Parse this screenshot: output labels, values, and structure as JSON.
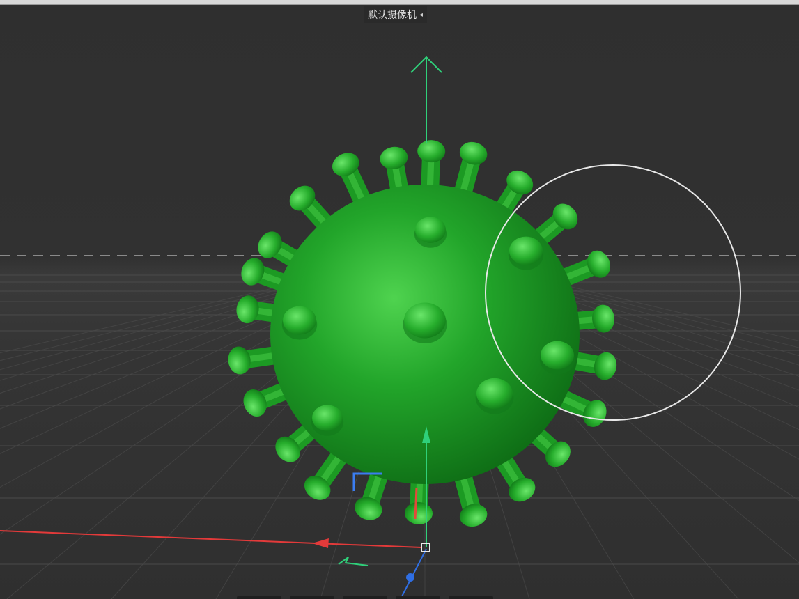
{
  "viewport": {
    "camera_label": "默认摄像机",
    "camera_icon": "camera-icon",
    "camera_dropdown_icon": "◂",
    "object_color": "#22a52a",
    "object_highlight": "#5fe35a",
    "object_shadow": "#0e6b14",
    "x_axis_color": "#e33a3a",
    "y_axis_color": "#2fd07a",
    "z_axis_color": "#2f6ee3"
  },
  "colors": {
    "background": "#333333",
    "grid_line": "#4a4a4a",
    "horizon_dash": "#8a8a8a",
    "selection_circle": "#e8e8e8"
  }
}
